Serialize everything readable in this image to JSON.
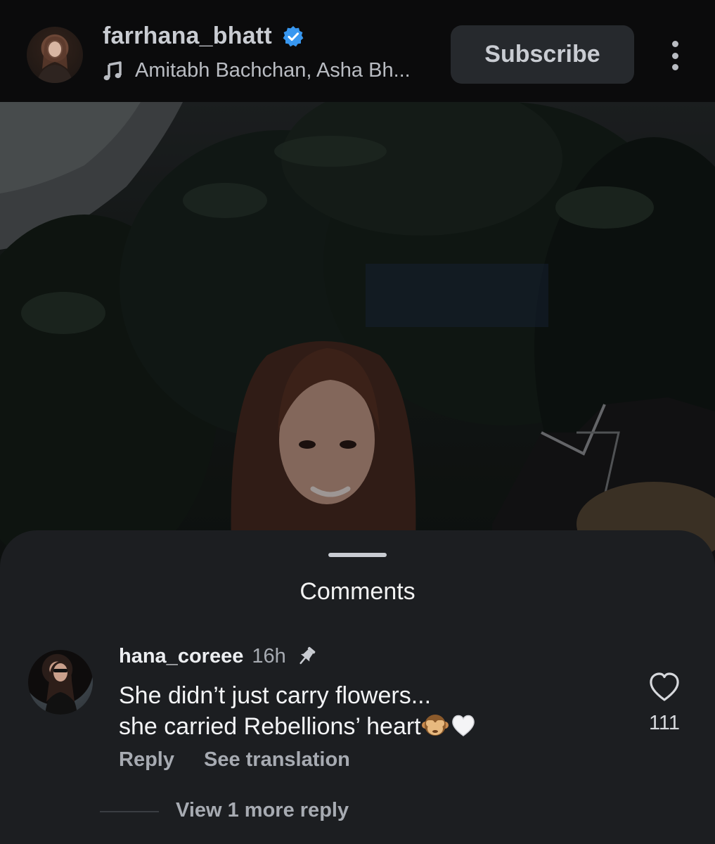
{
  "header": {
    "username": "farrhana_bhatt",
    "audio": "Amitabh Bachchan, Asha Bh...",
    "subscribe_label": "Subscribe"
  },
  "colors": {
    "verified_badge": "#3897f0",
    "sheet_background": "#1c1e21",
    "header_background": "#0b0b0c"
  },
  "icons": [
    "verified-badge-icon",
    "music-note-icon",
    "more-options-icon",
    "pin-icon",
    "heart-outline-icon"
  ],
  "comments_sheet": {
    "title": "Comments",
    "comments": [
      {
        "username": "hana_coreee",
        "time": "16h",
        "text_line1": "She didn’t just carry flowers...",
        "text_line2": "she carried Rebellions’ heart",
        "emojis": [
          "see-no-evil-monkey",
          "white-heart"
        ],
        "like_count": "111",
        "reply_label": "Reply",
        "translate_label": "See translation",
        "view_replies_label": "View 1 more reply"
      }
    ]
  }
}
